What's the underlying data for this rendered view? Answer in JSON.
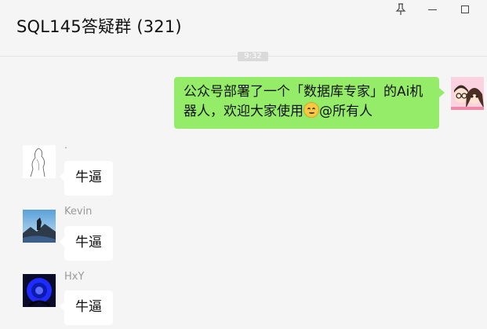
{
  "window": {
    "title": "SQL145答疑群 (321)",
    "pin_icon": "pin-icon",
    "minimize_icon": "minimize-icon",
    "maximize_icon": "maximize-icon"
  },
  "chat": {
    "timestamp": "9:32",
    "messages": [
      {
        "sender": "",
        "is_self": true,
        "text_line1": "公众号部署了一个「数据库专家」的Ai机",
        "text_line2_pre": "器人，欢迎大家使用",
        "emoji": "smiling-face-icon",
        "text_line2_post": "@所有人"
      },
      {
        "sender": ".",
        "is_self": false,
        "text": "牛逼"
      },
      {
        "sender": "Kevin",
        "is_self": false,
        "text": "牛逼"
      },
      {
        "sender": "HxY",
        "is_self": false,
        "text": "牛逼"
      }
    ]
  },
  "colors": {
    "self_bubble": "#95ec69",
    "other_bubble": "#ffffff",
    "background": "#f5f5f5"
  }
}
